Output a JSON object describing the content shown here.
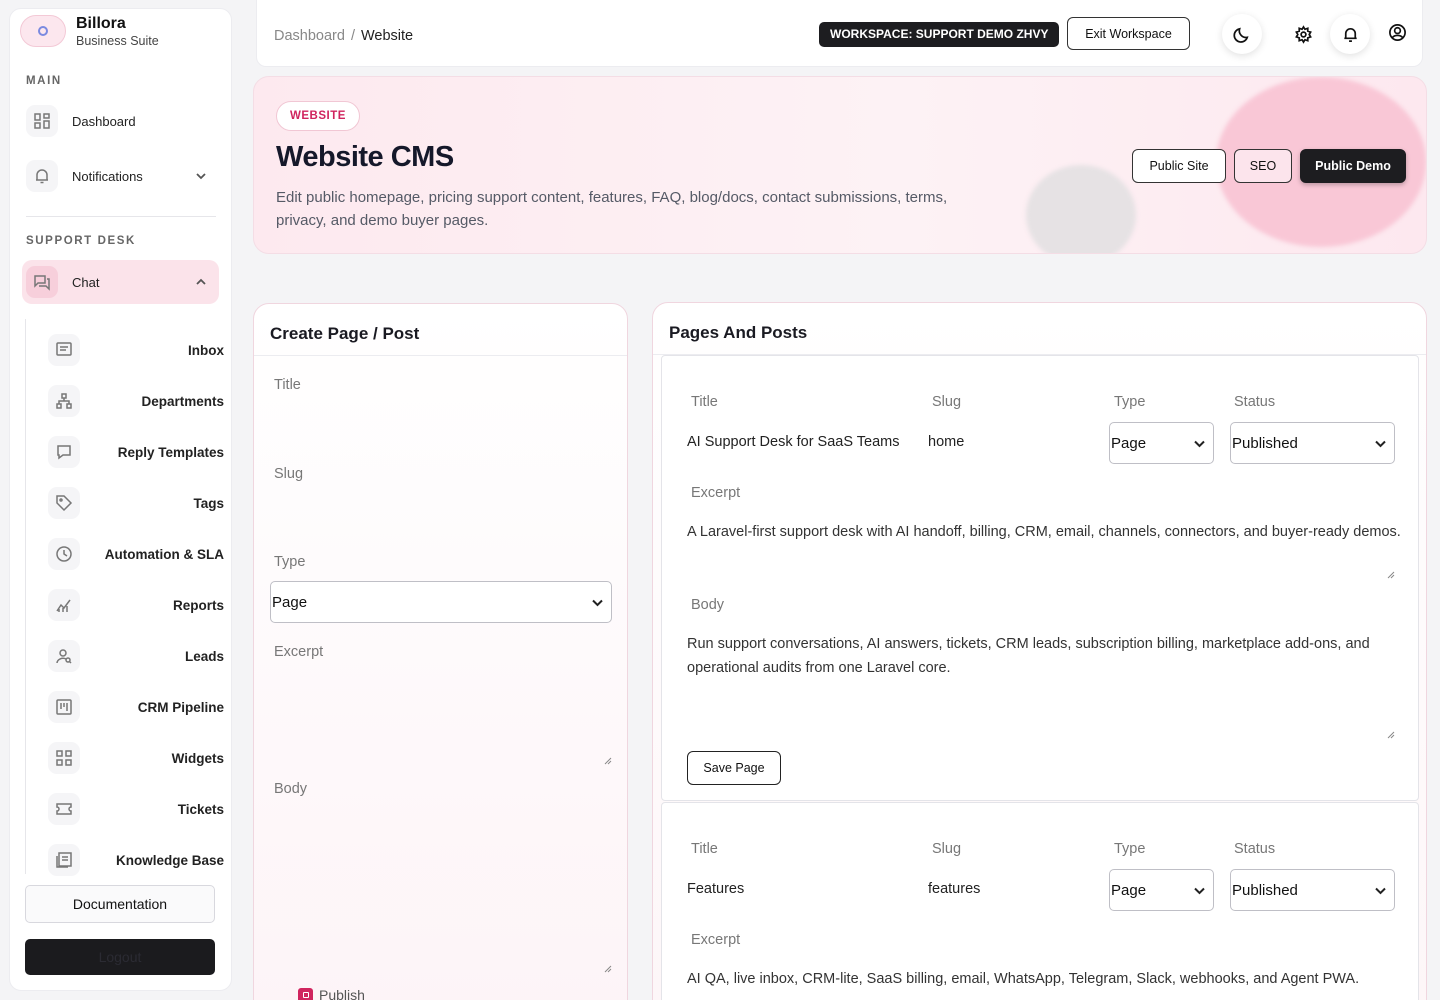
{
  "brand": {
    "name": "Billora",
    "subtitle": "Business Suite"
  },
  "sidebar": {
    "main_label": "MAIN",
    "main_items": [
      {
        "label": "Dashboard",
        "icon": "grid-icon"
      },
      {
        "label": "Notifications",
        "icon": "bell-icon"
      }
    ],
    "support_label": "SUPPORT DESK",
    "chat_label": "Chat",
    "sub_items": [
      {
        "label": "Inbox",
        "icon": "message-icon"
      },
      {
        "label": "Departments",
        "icon": "org-chart-icon"
      },
      {
        "label": "Reply Templates",
        "icon": "reply-template-icon"
      },
      {
        "label": "Tags",
        "icon": "tag-icon"
      },
      {
        "label": "Automation & SLA",
        "icon": "clock-icon"
      },
      {
        "label": "Reports",
        "icon": "chart-icon"
      },
      {
        "label": "Leads",
        "icon": "user-search-icon"
      },
      {
        "label": "CRM Pipeline",
        "icon": "pipeline-icon"
      },
      {
        "label": "Widgets",
        "icon": "widgets-icon"
      },
      {
        "label": "Tickets",
        "icon": "ticket-icon"
      },
      {
        "label": "Knowledge Base",
        "icon": "book-icon"
      }
    ],
    "documentation": "Documentation",
    "logout": "Logout"
  },
  "topbar": {
    "breadcrumb_root": "Dashboard",
    "breadcrumb_sep": "/",
    "breadcrumb_current": "Website",
    "workspace_badge": "WORKSPACE: SUPPORT DEMO ZHVY",
    "exit_workspace": "Exit Workspace"
  },
  "hero": {
    "tag": "WEBSITE",
    "title": "Website CMS",
    "description": "Edit public homepage, pricing support content, features, FAQ, blog/docs, contact submissions, terms, privacy, and demo buyer pages.",
    "buttons": {
      "public_site": "Public Site",
      "seo": "SEO",
      "public_demo": "Public Demo"
    }
  },
  "create": {
    "title": "Create Page / Post",
    "labels": {
      "title": "Title",
      "slug": "Slug",
      "type": "Type",
      "excerpt": "Excerpt",
      "body": "Body"
    },
    "type_value": "Page",
    "publish_label": "Publish"
  },
  "pages": {
    "title": "Pages And Posts",
    "labels": {
      "title": "Title",
      "slug": "Slug",
      "type": "Type",
      "status": "Status",
      "excerpt": "Excerpt",
      "body": "Body"
    },
    "save_label": "Save Page",
    "items": [
      {
        "title": "AI Support Desk for SaaS Teams",
        "slug": "home",
        "type": "Page",
        "status": "Published",
        "excerpt": "A Laravel-first support desk with AI handoff, billing, CRM, email, channels, connectors, and buyer-ready demos.",
        "body": "Run support conversations, AI answers, tickets, CRM leads, subscription billing, marketplace add-ons, and operational audits from one Laravel core."
      },
      {
        "title": "Features",
        "slug": "features",
        "type": "Page",
        "status": "Published",
        "excerpt": "AI QA, live inbox, CRM-lite, SaaS billing, email, WhatsApp, Telegram, Slack, webhooks, and Agent PWA."
      }
    ]
  },
  "colors": {
    "accent": "#d0245e",
    "accent_soft": "#fbe3ea",
    "dark": "#1d1d20"
  }
}
